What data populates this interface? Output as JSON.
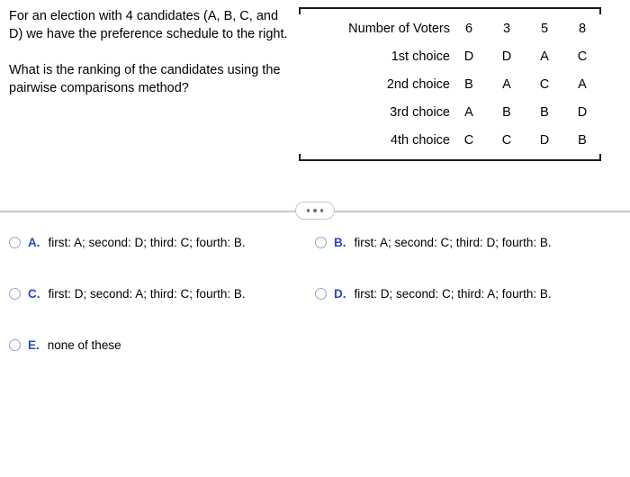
{
  "question": {
    "paragraph1": "For an election with 4 candidates (A, B, C, and D) we have the preference schedule to the right.",
    "paragraph2": "What is the ranking of the candidates using the pairwise comparisons method?"
  },
  "schedule": {
    "header_label": "Number of Voters",
    "voter_counts": [
      "6",
      "3",
      "5",
      "8"
    ],
    "rows": [
      {
        "label": "1st choice",
        "cells": [
          "D",
          "D",
          "A",
          "C"
        ]
      },
      {
        "label": "2nd choice",
        "cells": [
          "B",
          "A",
          "C",
          "A"
        ]
      },
      {
        "label": "3rd choice",
        "cells": [
          "A",
          "B",
          "B",
          "D"
        ]
      },
      {
        "label": "4th choice",
        "cells": [
          "C",
          "C",
          "D",
          "B"
        ]
      }
    ]
  },
  "divider": {
    "expand_icon": "ellipsis-icon"
  },
  "options": [
    {
      "letter": "A.",
      "text": "first: A; second: D; third: C; fourth: B."
    },
    {
      "letter": "B.",
      "text": "first: A; second: C; third: D; fourth: B."
    },
    {
      "letter": "C.",
      "text": "first: D; second: A; third: C; fourth: B."
    },
    {
      "letter": "D.",
      "text": "first: D; second: C; third: A; fourth: B."
    },
    {
      "letter": "E.",
      "text": "none of these"
    }
  ],
  "colors": {
    "option_letter": "#2a4bb5",
    "radio_border": "#9aa2c4",
    "divider": "#c5c6cf",
    "bracket": "#1a1a1a"
  }
}
